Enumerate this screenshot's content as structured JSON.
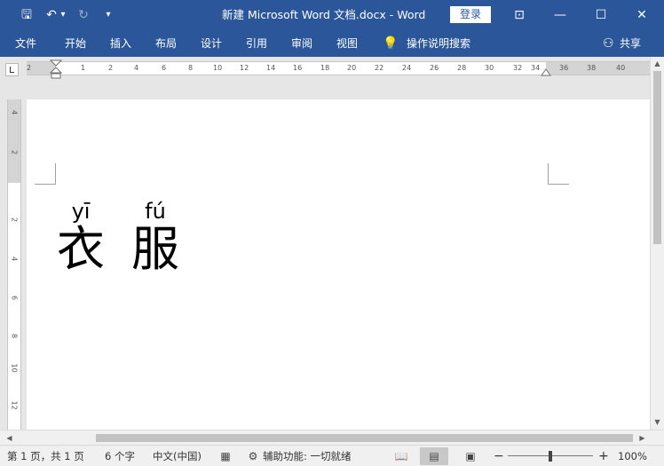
{
  "titlebar": {
    "doc_title": "新建 Microsoft Word 文档.docx  -  Word",
    "signin_label": "登录",
    "icons": [
      "save-icon",
      "undo-icon",
      "redo-icon",
      "customize-icon",
      "ribbon-display-icon",
      "minimize-icon",
      "maximize-icon",
      "close-icon"
    ],
    "glyphs": {
      "save": "🖫",
      "undo": "↶",
      "undo_dd": "▾",
      "redo": "↻",
      "customize": "▾",
      "ribbon": "⊡",
      "min": "—",
      "max": "☐",
      "close": "✕"
    }
  },
  "ribbon": {
    "tabs": [
      "文件",
      "开始",
      "插入",
      "布局",
      "设计",
      "引用",
      "审阅",
      "视图"
    ],
    "search": "操作说明搜索",
    "share": "共享",
    "bulb": "💡",
    "person": "⚇"
  },
  "ruler": {
    "h_ticks": [
      "2",
      "1",
      "2",
      "4",
      "6",
      "8",
      "10",
      "12",
      "14",
      "16",
      "18",
      "20",
      "22",
      "24",
      "26",
      "28",
      "30",
      "32",
      "34",
      "36",
      "38",
      "40"
    ],
    "v_ticks": [
      "4",
      "2",
      "2",
      "4",
      "6",
      "8",
      "10",
      "12"
    ]
  },
  "document": {
    "characters": [
      {
        "pinyin": "yī",
        "hanzi": "衣"
      },
      {
        "pinyin": "fú",
        "hanzi": "服"
      }
    ]
  },
  "scroll": {
    "up": "▲",
    "down": "▼",
    "left": "◀",
    "right": "▶"
  },
  "status": {
    "page": "第 1 页，共 1 页",
    "words": "6 个字",
    "language": "中文(中国)",
    "accessibility": "辅助功能: 一切就绪",
    "zoom_minus": "−",
    "zoom_plus": "+",
    "zoom": "100%",
    "icons": {
      "macro": "▦",
      "access": "⚙",
      "read": "📖",
      "print": "▤",
      "web": "▣"
    }
  },
  "colors": {
    "brand": "#2b579a",
    "page": "#ffffff",
    "chrome": "#e6e6e6"
  }
}
